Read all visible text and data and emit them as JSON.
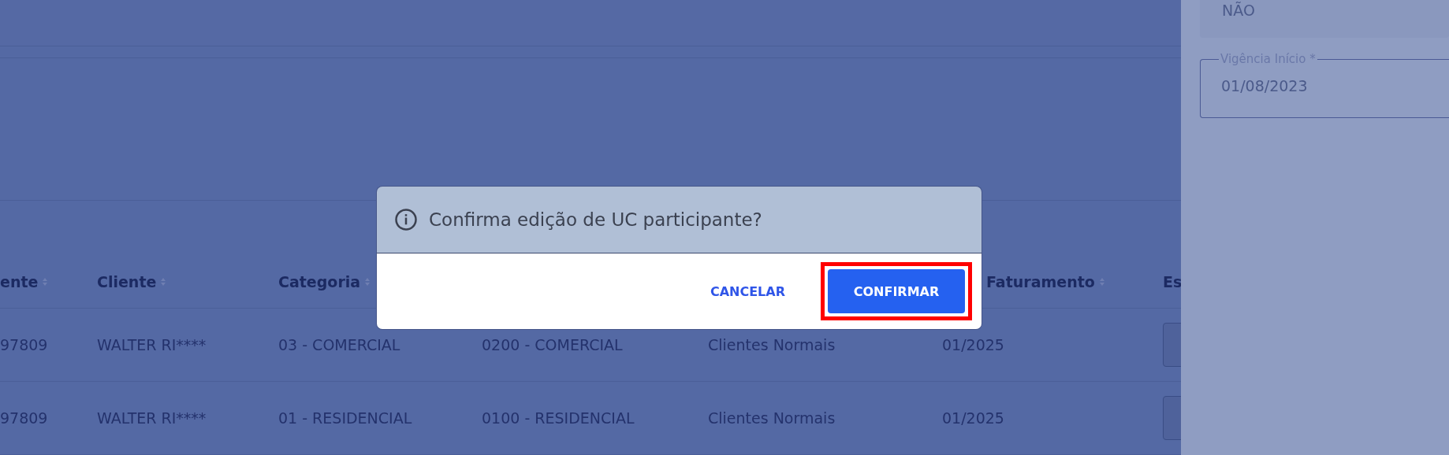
{
  "table": {
    "columns": [
      {
        "label": "ente",
        "sortable": true
      },
      {
        "label": "Cliente",
        "sortable": true
      },
      {
        "label": "Categoria",
        "sortable": true
      },
      {
        "label": "Faturamento",
        "sortable": true
      },
      {
        "label": "Es",
        "sortable": false
      }
    ],
    "rows": [
      {
        "cells": [
          "97809",
          "WALTER RI****",
          "03 - COMERCIAL",
          "0200 - COMERCIAL",
          "Clientes Normais",
          "01/2025"
        ],
        "has_field": true
      },
      {
        "cells": [
          "97809",
          "WALTER RI****",
          "01 - RESIDENCIAL",
          "0100 - RESIDENCIAL",
          "Clientes Normais",
          "01/2025"
        ],
        "has_field": true
      }
    ]
  },
  "side_panel": {
    "fields": [
      {
        "kind": "filled",
        "value": "NÃO"
      },
      {
        "kind": "outlined",
        "label": "Vigência Início *",
        "value": "01/08/2023"
      }
    ]
  },
  "dialog": {
    "message": "Confirma edição de UC participante?",
    "buttons": [
      {
        "label": "CANCELAR",
        "kind": "text",
        "highlighted": false
      },
      {
        "label": "CONFIRMAR",
        "kind": "contained",
        "highlighted": true
      }
    ]
  }
}
